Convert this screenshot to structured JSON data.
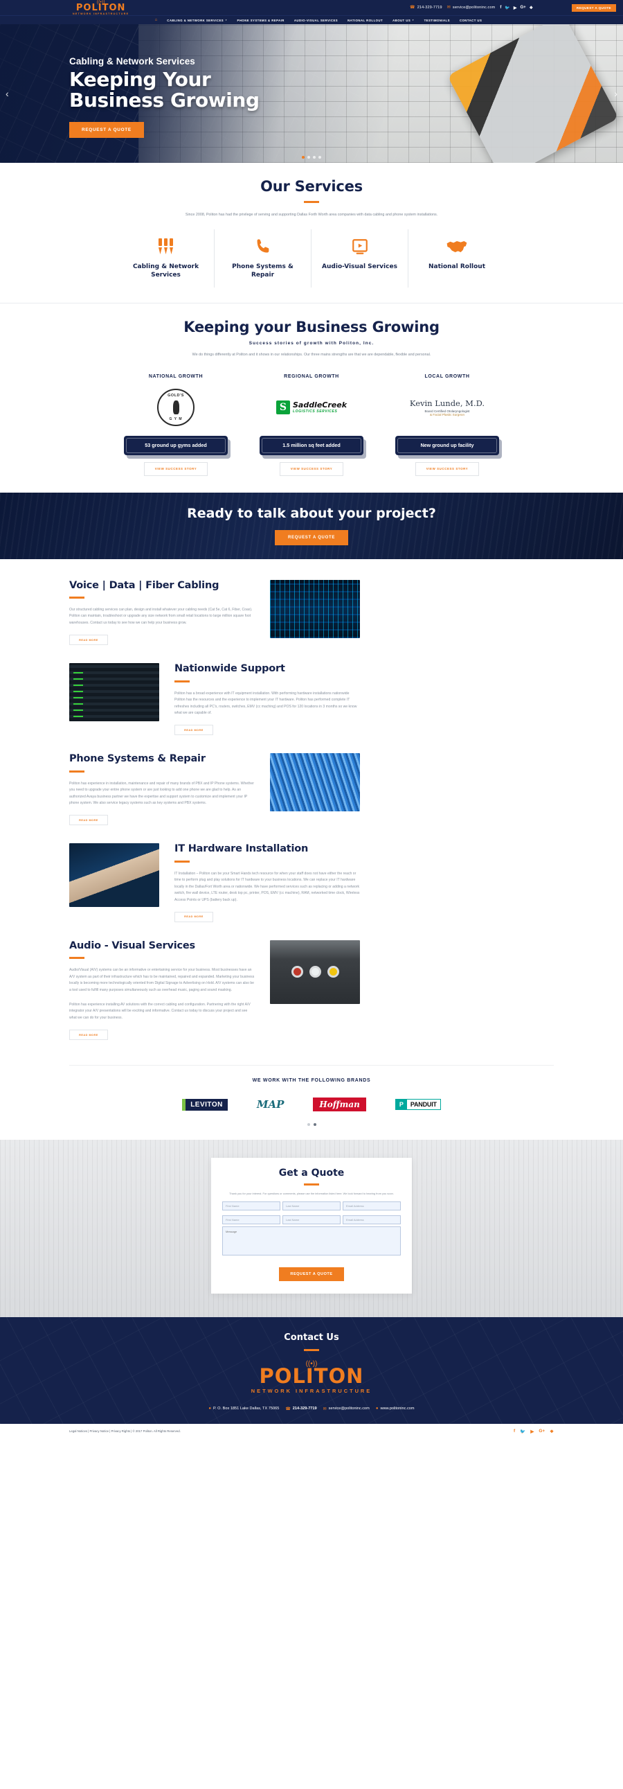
{
  "brand": {
    "name": "POLITON",
    "tagline": "NETWORK INFRASTRUCTURE",
    "accent": "#f07d20",
    "navy": "#15224b"
  },
  "topbar": {
    "phone": "214-329-7719",
    "email": "service@politoninc.com",
    "quote_label": "REQUEST A QUOTE",
    "social": [
      "facebook",
      "twitter",
      "youtube",
      "google-plus",
      "yelp"
    ]
  },
  "nav": {
    "home_icon": "home-icon",
    "items": [
      {
        "label": "CABLING & NETWORK SERVICES",
        "has_caret": true
      },
      {
        "label": "PHONE SYSTEMS & REPAIR",
        "has_caret": false
      },
      {
        "label": "AUDIO-VISUAL SERVICES",
        "has_caret": false
      },
      {
        "label": "NATIONAL ROLLOUT",
        "has_caret": false
      },
      {
        "label": "ABOUT US",
        "has_caret": true
      },
      {
        "label": "TESTIMONIALS",
        "has_caret": false
      },
      {
        "label": "CONTACT US",
        "has_caret": false
      }
    ]
  },
  "hero": {
    "kicker": "Cabling & Network Services",
    "title_line1": "Keeping Your",
    "title_line2": "Business Growing",
    "button": "REQUEST A QUOTE",
    "prev": "‹",
    "next": "›"
  },
  "services": {
    "title": "Our Services",
    "subtitle": "Since 2008, Politon has had the privilege of serving and supporting Dallas Forth Worth area companies with data cabling and phone system installations.",
    "cards": [
      {
        "icon": "cable-connectors-icon",
        "label": "Cabling & Network Services"
      },
      {
        "icon": "phone-icon",
        "label": "Phone Systems & Repair"
      },
      {
        "icon": "video-play-icon",
        "label": "Audio-Visual Services"
      },
      {
        "icon": "usa-map-icon",
        "label": "National Rollout"
      }
    ]
  },
  "growth": {
    "title": "Keeping your Business Growing",
    "subtitle": "Success stories of growth with Politon, Inc.",
    "description": "We do things differently at Politon and it shows in our relationships. Our three mains strengths are that we are dependable, flexible and personal.",
    "columns": [
      {
        "category": "NATIONAL GROWTH",
        "logo": "golds-gym-logo",
        "logo_text": "GOLD'S GYM",
        "plaque": "53 ground up gyms added",
        "story_button": "VIEW SUCCESS STORY"
      },
      {
        "category": "REGIONAL GROWTH",
        "logo": "saddle-creek-logo",
        "logo_text": "SaddleCreek",
        "logo_subtext": "LOGISTICS SERVICES",
        "plaque": "1.5 million sq feet added",
        "story_button": "VIEW SUCCESS STORY"
      },
      {
        "category": "LOCAL GROWTH",
        "logo": "kevin-lunde-md-logo",
        "logo_text": "Kevin Lunde, M.D.",
        "logo_subtext": "Board Certified Otolaryngologist",
        "logo_subtext2": "& Facial Plastic Surgeon",
        "plaque": "New ground up facility",
        "story_button": "VIEW SUCCESS STORY"
      }
    ]
  },
  "cta": {
    "title": "Ready to talk about your project?",
    "button": "REQUEST A QUOTE"
  },
  "blocks": [
    {
      "title": "Voice | Data | Fiber Cabling",
      "body": "Our structured cabling services can plan, design and install whatever your cabling needs (Cat 5e, Cat 6, Fiber, Coax). Politon can maintain, troubleshoot or upgrade any size network from small retail locations to large million square foot warehouses. Contact us today to see how we can help your business grow.",
      "button": "READ MORE",
      "image": "data-center-servers-image",
      "reversed": false
    },
    {
      "title": "Nationwide Support",
      "body": "Politon has a broad experience with IT equipment installation. With performing hardware installations nationwide Politon has the resources and the experience to implement your IT hardware. Politon has performed complete IT refreshes including all PC's, routers, switches, EMV (cc maching) and POS for 120 locations in 3 months so we know what we are capable of.",
      "button": "READ MORE",
      "image": "server-rack-tablet-image",
      "reversed": true
    },
    {
      "title": "Phone Systems & Repair",
      "body": "Politon has experience in installation, maintenance and repair of many brands of PBX and IP Phone systems. Whether you need to upgrade your entire phone system or are just looking to add one phone we are glad to help. As an authorized Avaya business partner we have the expertise and support system to customize and implement your IP phone system. We also service legacy systems such as key systems and PBX systems.",
      "button": "READ MORE",
      "image": "blue-network-cables-image",
      "reversed": false
    },
    {
      "title": "IT Hardware Installation",
      "body": "IT Installation – Politon can be your Smart Hands tech resource for when your staff does not have either the reach or time to perform plug and play solutions for IT hardware to your business locations. We can replace your IT hardware locally in the Dallas/Fort Worth area or nationwide. We have performed services such as replacing or adding a network switch, fire wall device, LTE router, desk top pc, printer, POS, EMV (cc machine), RAM, networked time clock, Wireless Access Points or UPS (battery back up).",
      "button": "READ MORE",
      "image": "technician-rack-hands-image",
      "reversed": true
    },
    {
      "title": "Audio - Visual Services",
      "body": "Audio/Visual (A/V) systems can be an informative or entertaining service for your business. Most businesses have an A/V system as part of their infrastructure which has to be maintained, repaired and expanded. Marketing your business locally is becoming more technologically oriented from Digital Signage to Advertising on Hold. A/V systems can also be a tool used to fulfill many purposes simultaneously such as overhead music, paging and sound masking.",
      "body2": "Politon has experience installing AV solutions with the correct cabling and configuration. Partnering with the right A/V integrator your A/V presentations will be exciting and informative. Contact us today to discuss your project and see what we can do for your business.",
      "button": "READ MORE",
      "image": "rca-audio-ports-image",
      "reversed": false
    }
  ],
  "brands": {
    "title": "WE WORK WITH THE FOLLOWING BRANDS",
    "logos": [
      {
        "name": "leviton-logo",
        "text": "LEVITON"
      },
      {
        "name": "middle-atlantic-products-logo",
        "text": "MAP"
      },
      {
        "name": "hoffman-logo",
        "text": "Hoffman"
      },
      {
        "name": "panduit-logo",
        "text": "PANDUIT",
        "mark": "P"
      }
    ],
    "dots": 2,
    "active_dot": 1
  },
  "quote": {
    "title": "Get a Quote",
    "note": "Thank you for your interest. For questions or comments, please use the information listed here. We look forward to hearing from you soon.",
    "fields": {
      "first_name": "First Name",
      "last_name": "Last Name",
      "email": "Email Address",
      "first_name_2": "First Name",
      "last_name_2": "Last Name",
      "email_2": "Email Address",
      "message": "Message"
    },
    "button": "REQUEST A QUOTE"
  },
  "footer": {
    "title": "Contact Us",
    "logo_name": "POLITON",
    "logo_tagline": "NETWORK INFRASTRUCTURE",
    "address": "P. O. Box 1851 Lake Dallas, TX 75065",
    "phone": "214-329-7719",
    "email": "service@politoninc.com",
    "website": "www.politoninc.com",
    "legal": "Legal Notices | Privacy Notice | Privacy Rights | © 2017 Politon. All Rights Reserved.",
    "social": [
      "facebook",
      "twitter",
      "youtube",
      "google-plus",
      "yelp"
    ]
  }
}
